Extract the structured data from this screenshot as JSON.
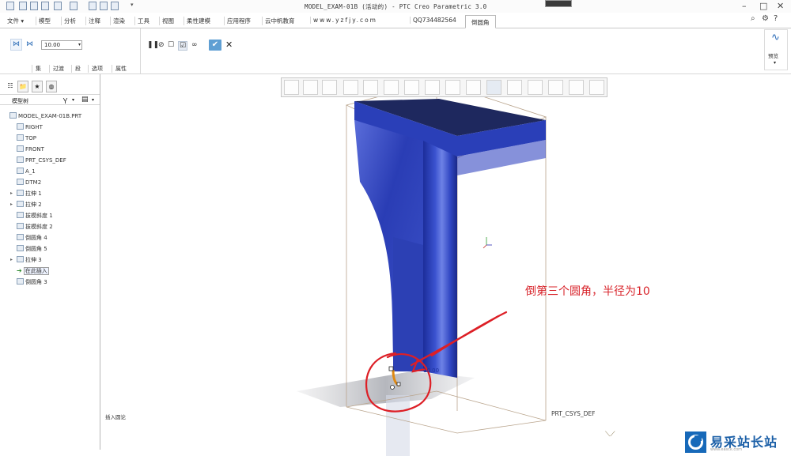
{
  "window": {
    "title": "MODEL_EXAM-01B (活动的) - PTC Creo Parametric 3.0"
  },
  "menu": {
    "tabs": [
      "文件",
      "模型",
      "分析",
      "注释",
      "渲染",
      "工具",
      "视图",
      "柔性建模",
      "应用程序",
      "云中帆教育",
      "www.yzfjy.com",
      "QQ734482564"
    ],
    "active_tab": "倒圆角"
  },
  "ribbon": {
    "radius_value": "10.00",
    "lower_tabs": [
      "集",
      "过渡",
      "段",
      "选项",
      "属性"
    ],
    "preview_label": "预览"
  },
  "model_tree": {
    "title": "模型树",
    "items": [
      {
        "label": "MODEL_EXAM-01B.PRT",
        "level": 0,
        "expandable": false
      },
      {
        "label": "RIGHT",
        "level": 1,
        "expandable": false
      },
      {
        "label": "TOP",
        "level": 1,
        "expandable": false
      },
      {
        "label": "FRONT",
        "level": 1,
        "expandable": false
      },
      {
        "label": "PRT_CSYS_DEF",
        "level": 1,
        "expandable": false
      },
      {
        "label": "A_1",
        "level": 1,
        "expandable": false
      },
      {
        "label": "DTM2",
        "level": 1,
        "expandable": false
      },
      {
        "label": "拉伸 1",
        "level": 1,
        "expandable": true
      },
      {
        "label": "拉伸 2",
        "level": 1,
        "expandable": true
      },
      {
        "label": "拔模斜度 1",
        "level": 1,
        "expandable": false
      },
      {
        "label": "拔模斜度 2",
        "level": 1,
        "expandable": false
      },
      {
        "label": "倒圆角 4",
        "level": 1,
        "expandable": false
      },
      {
        "label": "倒圆角 5",
        "level": 1,
        "expandable": false
      },
      {
        "label": "拉伸 3",
        "level": 1,
        "expandable": true
      },
      {
        "label": "在此插入",
        "level": 1,
        "expandable": false
      },
      {
        "label": "倒圆角 3",
        "level": 1,
        "expandable": false
      }
    ]
  },
  "status": {
    "text": "插入圆论"
  },
  "viewport": {
    "annotation": "倒第三个圆角，半径为10",
    "dimension": "10.00",
    "csys_label": "PRT_CSYS_DEF",
    "datum_marks": "⟍⟋"
  },
  "watermark": {
    "name": "易采站长站",
    "url": "www.easck.com"
  },
  "colors": {
    "model_blue": "#2a3fb8",
    "annotation_red": "#d8232a",
    "accent_blue": "#1769b9"
  }
}
